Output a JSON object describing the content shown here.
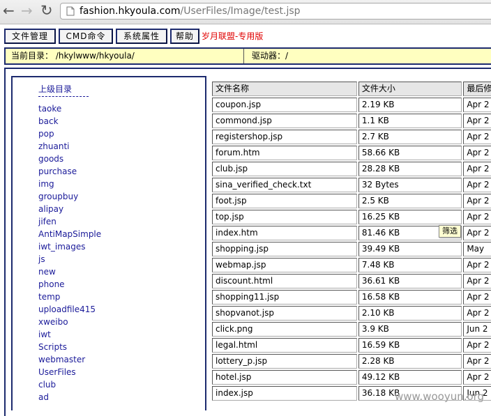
{
  "browser": {
    "url_host": "fashion.hkyoula.com",
    "url_path": "/UserFiles/Image/test.jsp",
    "back_icon": "arrow-left-icon",
    "forward_icon": "arrow-right-icon",
    "reload_icon": "reload-icon"
  },
  "toolbar": {
    "buttons": [
      "文件管理",
      "CMD命令",
      "系统属性",
      "帮助"
    ],
    "brand": "岁月联盟-专用版"
  },
  "pathbar": {
    "current_dir_label": "当前目录：",
    "current_dir": "/hkylwww/hkyoula/",
    "drive_label": "驱动器：",
    "drive": "/"
  },
  "sidebar": {
    "up_label": "上级目录",
    "dirs": [
      "taoke",
      "back",
      "pop",
      "zhuanti",
      "goods",
      "purchase",
      "img",
      "groupbuy",
      "alipay",
      "jifen",
      "AntiMapSimple",
      "iwt_images",
      "js",
      "new",
      "phone",
      "temp",
      "uploadfile415",
      "xweibo",
      "iwt",
      "Scripts",
      "webmaster",
      "UserFiles",
      "club",
      "ad"
    ]
  },
  "table": {
    "headers": [
      "文件名称",
      "文件大小",
      "最后修改"
    ],
    "rows": [
      [
        "coupon.jsp",
        "2.19 KB",
        "Apr 2"
      ],
      [
        "commond.jsp",
        "1.1 KB",
        "Apr 2"
      ],
      [
        "registershop.jsp",
        "2.7 KB",
        "Apr 2"
      ],
      [
        "forum.htm",
        "58.66 KB",
        "Apr 2"
      ],
      [
        "club.jsp",
        "28.28 KB",
        "Apr 2"
      ],
      [
        "sina_verified_check.txt",
        "32 Bytes",
        "Apr 2"
      ],
      [
        "foot.jsp",
        "2.5 KB",
        "Apr 2"
      ],
      [
        "top.jsp",
        "16.25 KB",
        "Apr 2"
      ],
      [
        "index.htm",
        "81.46 KB",
        "Apr 2"
      ],
      [
        "shopping.jsp",
        "39.49 KB",
        "May"
      ],
      [
        "webmap.jsp",
        "7.48 KB",
        "Apr 2"
      ],
      [
        "discount.html",
        "36.61 KB",
        "Apr 2"
      ],
      [
        "shopping11.jsp",
        "16.58 KB",
        "Apr 2"
      ],
      [
        "shopvanot.jsp",
        "2.10 KB",
        "Apr 2"
      ],
      [
        "click.png",
        "3.9 KB",
        "Jun 2"
      ],
      [
        "legal.html",
        "16.59 KB",
        "Apr 2"
      ],
      [
        "lottery_p.jsp",
        "2.28 KB",
        "Apr 2"
      ],
      [
        "hotel.jsp",
        "49.12 KB",
        "Apr 2"
      ],
      [
        "index.jsp",
        "36.18 KB",
        "Jun 2"
      ]
    ]
  },
  "tooltip": "筛选",
  "watermark": "www.wooyun.org"
}
